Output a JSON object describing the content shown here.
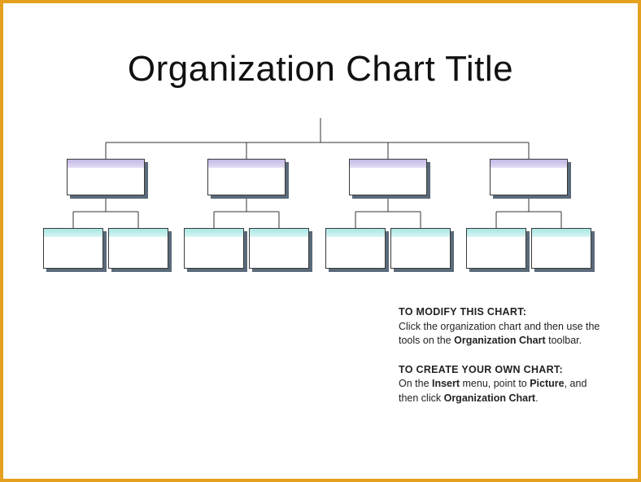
{
  "title": "Organization Chart Title",
  "instructions": {
    "modify": {
      "heading": "TO MODIFY THIS CHART:",
      "line1_a": "Click the organization chart and then use the tools on the ",
      "bold_a": "Organization Chart",
      "line1_b": " toolbar."
    },
    "create": {
      "heading": "TO CREATE YOUR OWN CHART:",
      "line1_a": "On the ",
      "bold_a": "Insert",
      "line1_b": " menu, point to ",
      "bold_b": "Picture",
      "line1_c": ", and then click ",
      "bold_c": "Organization Chart",
      "line1_d": "."
    }
  },
  "chart_data": {
    "type": "org-chart",
    "root": {
      "label": "",
      "children": [
        {
          "label": "",
          "color": "purple",
          "children": [
            {
              "label": "",
              "color": "teal"
            },
            {
              "label": "",
              "color": "teal"
            }
          ]
        },
        {
          "label": "",
          "color": "purple",
          "children": [
            {
              "label": "",
              "color": "teal"
            },
            {
              "label": "",
              "color": "teal"
            }
          ]
        },
        {
          "label": "",
          "color": "purple",
          "children": [
            {
              "label": "",
              "color": "teal"
            },
            {
              "label": "",
              "color": "teal"
            }
          ]
        },
        {
          "label": "",
          "color": "purple",
          "children": [
            {
              "label": "",
              "color": "teal"
            },
            {
              "label": "",
              "color": "teal"
            }
          ]
        }
      ]
    },
    "colors": {
      "purple": "#c4b8e6",
      "teal": "#a6e6e3",
      "border": "#3a3a3a"
    }
  }
}
